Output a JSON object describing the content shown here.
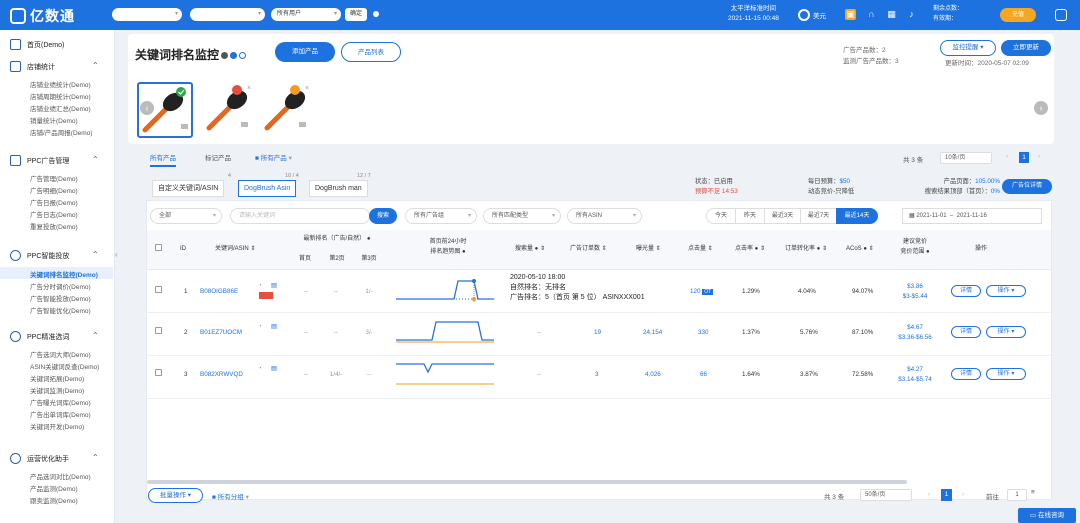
{
  "header": {
    "logo": "亿数通",
    "selects": [
      "",
      "",
      "所有用户"
    ],
    "apply": "确定",
    "time_label": "太平洋标准时间",
    "time": "2021-11-15 00:48",
    "unit_label": "美元",
    "balance_label": "剩余点数：",
    "expire_label": "有效期：",
    "balance_value": "",
    "expire_value": "",
    "vip": "充值"
  },
  "sidebar": {
    "groups": [
      {
        "label": "首页(Demo)",
        "items": []
      },
      {
        "label": "店铺统计",
        "items": [
          "店铺业绩统计(Demo)",
          "店铺周期统计(Demo)",
          "店铺业绩汇总(Demo)",
          "销量统计(Demo)",
          "店铺/产品周报(Demo)"
        ]
      },
      {
        "label": "PPC广告管理",
        "items": [
          "广告管理(Demo)",
          "广告明细(Demo)",
          "广告日报(Demo)",
          "广告日志(Demo)",
          "重复投放(Demo)"
        ]
      },
      {
        "label": "PPC智能投放",
        "items": [
          "关键词排名监控(Demo)",
          "广告分时调价(Demo)",
          "广告智能投放(Demo)",
          "广告智能优化(Demo)"
        ]
      },
      {
        "label": "PPC精准选词",
        "items": [
          "广告选词大师(Demo)",
          "ASIN关键词反查(Demo)",
          "关键词拓展(Demo)",
          "关键词监测(Demo)",
          "广告曝光词库(Demo)",
          "广告出单词库(Demo)",
          "关键词开发(Demo)"
        ]
      },
      {
        "label": "运营优化助手",
        "items": [
          "产品选词对比(Demo)",
          "产品监测(Demo)",
          "跟卖监测(Demo)"
        ]
      }
    ]
  },
  "page": {
    "title": "关键词排名监控",
    "add_product": "添加产品",
    "product_list": "产品列表",
    "ad_products_label": "广告产品数：",
    "ad_products": "2",
    "monitored_label": "监测广告产品数：",
    "monitored": "3",
    "alert_btn": "监控提醒",
    "refresh_btn": "立即更新",
    "updated_label": "更新时间：",
    "updated": "2020-05-07 02:09"
  },
  "tabs": {
    "all": "所有产品",
    "marked": "标记产品",
    "folder": "所有产品",
    "total": "共 3 条",
    "per_page": "10条/页",
    "page": "1"
  },
  "keywords": {
    "custom": "自定义关键词/ASIN",
    "kw1": "DogBrush Asin",
    "kw2": "DogBrush man",
    "c0": "4",
    "c1": "10 / 4",
    "c2": "12 / 7"
  },
  "budget": {
    "status": "状态：已启用",
    "under": "预算不足 14:53",
    "daily": "每日预算：",
    "daily_val": "$50",
    "dynamic": "动态竞价-只降低",
    "pos": "产品页面：",
    "pos_val": "105.00%",
    "top": "搜索结果顶部（首页）：",
    "top_val": "0%",
    "btn": "广告位详情"
  },
  "filters": {
    "all": "全部",
    "search_ph": "请输入关键词",
    "search": "搜索",
    "campaign": "所有广告组",
    "match": "所有匹配类型",
    "asin": "所有ASIN",
    "ranges": [
      "今天",
      "昨天",
      "最近3天",
      "最近7天",
      "最近14天"
    ],
    "date_from": "2021-11-01",
    "date_to": "2021-11-16"
  },
  "table": {
    "headers": {
      "id": "ID",
      "kw": "关键词/ASIN",
      "rank": "最新排名（广告/自然）",
      "rank_sub": [
        "首页",
        "第2页",
        "第3页"
      ],
      "trend": "首页前24小时",
      "trend2": "排名趋势图",
      "impr": "搜索量",
      "orders": "广告订单数",
      "exposure": "曝光量",
      "clicks": "点击量",
      "ctr": "点击率",
      "cvr": "订单转化率",
      "acos": "ACoS",
      "bid": "建议竞价",
      "bid2": "竞价范围",
      "ops": "操作"
    },
    "rows": [
      {
        "id": "1",
        "asin": "B08OIGB86E",
        "r1": "--",
        "r2": "--",
        "r3": "1/-",
        "impr": "",
        "orders": "",
        "exp": "",
        "clicks": "120",
        "ctr": "1.29%",
        "cvr": "4.04%",
        "acos": "94.07%",
        "bid": "$3.86",
        "range": "$3-$5.44"
      },
      {
        "id": "2",
        "asin": "B01EZ7UOCM",
        "r1": "--",
        "r2": "--",
        "r3": "3/-",
        "impr": "--",
        "orders": "19",
        "exp": "24,154",
        "clicks": "330",
        "ctr": "1.37%",
        "cvr": "5.76%",
        "acos": "87.10%",
        "bid": "$4.67",
        "range": "$3.36-$6.56"
      },
      {
        "id": "3",
        "asin": "B082XRWVQD",
        "r1": "--",
        "r2": "1/4/-",
        "r3": "--",
        "impr": "--",
        "orders": "3",
        "exp": "4,026",
        "clicks": "66",
        "ctr": "1.64%",
        "cvr": "3.87%",
        "acos": "72.58%",
        "bid": "$4.27",
        "range": "$3.14-$5.74"
      }
    ],
    "tooltip": {
      "time": "2020-05-10 18:00",
      "natural": "自然排名：无排名",
      "ad": "广告排名：5（首页 第 5 位） ASINXXX001"
    },
    "detail": "详情",
    "op": "操作"
  },
  "footer": {
    "bulk": "批量操作",
    "group": "所有分组",
    "total": "共 3 条",
    "per_page": "50条/页",
    "page": "1",
    "goto": "前往",
    "goto_val": "1"
  },
  "help": "在线咨询"
}
